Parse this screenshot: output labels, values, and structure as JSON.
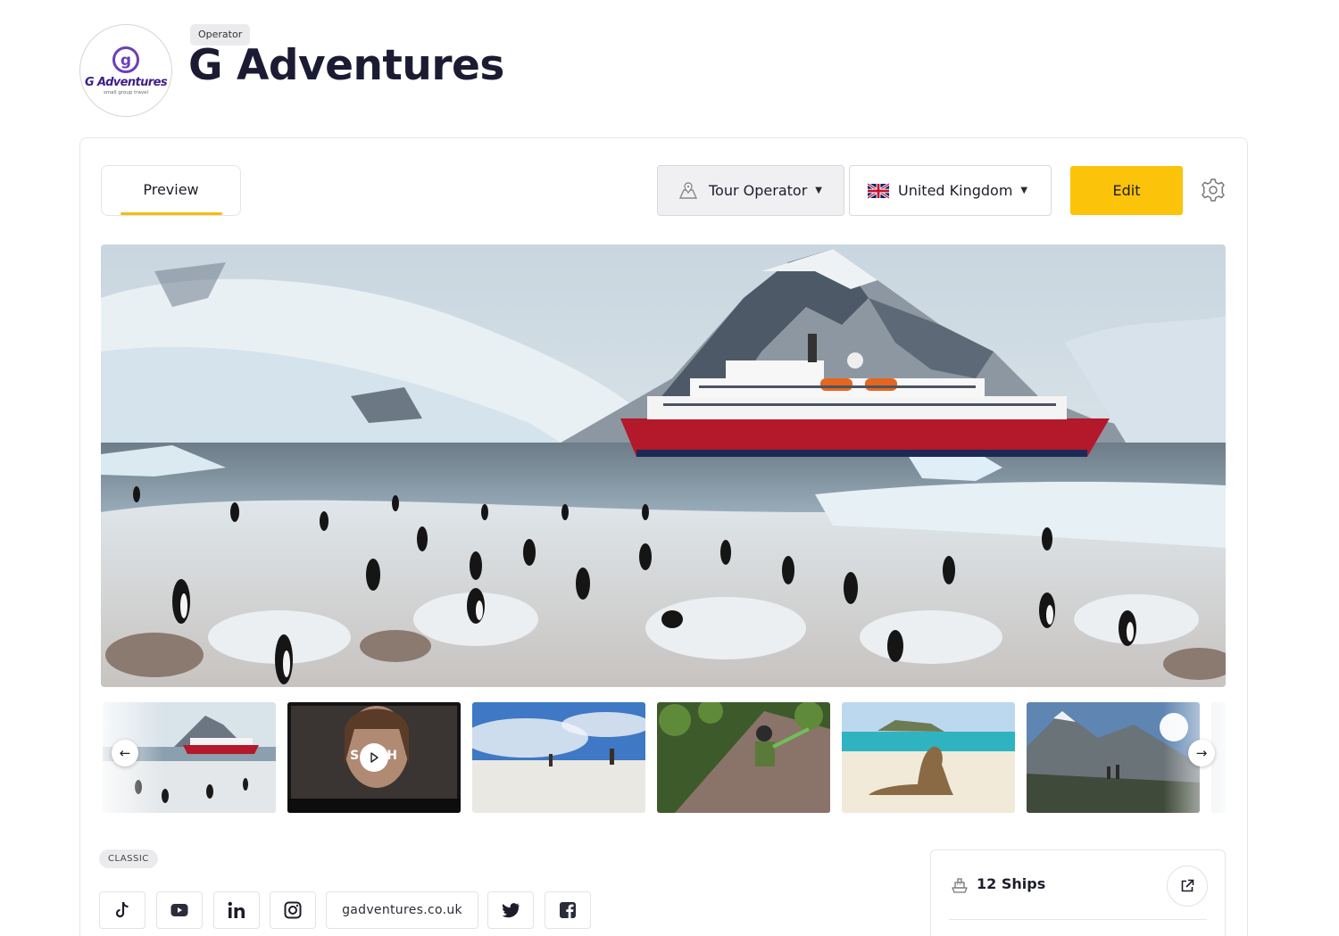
{
  "operator": {
    "type_badge": "Operator",
    "name": "G Adventures",
    "logo_wordmark": "G Adventures",
    "logo_tagline": "small group travel"
  },
  "toolbar": {
    "tab_preview": "Preview",
    "type_select": {
      "value": "Tour Operator",
      "icon": "map-icon"
    },
    "country_select": {
      "value": "United Kingdom",
      "icon": "uk-flag-icon"
    },
    "edit_label": "Edit",
    "settings_icon": "gear-icon"
  },
  "gallery": {
    "hero_alt": "Expedition ship in Antarctica with penguin colony",
    "thumbnails": [
      {
        "kind": "image",
        "subject": "ship-penguins"
      },
      {
        "kind": "video",
        "overlay_text": "SO   CH"
      },
      {
        "kind": "image",
        "subject": "beach-walkers"
      },
      {
        "kind": "image",
        "subject": "climber"
      },
      {
        "kind": "image",
        "subject": "sea-lion-beach"
      },
      {
        "kind": "image",
        "subject": "mountain-hikers"
      }
    ],
    "prev_icon": "arrow-left-icon",
    "next_icon": "arrow-right-icon"
  },
  "badge_classic": "CLASSIC",
  "links": {
    "website": "gadventures.co.uk",
    "socials": [
      "tiktok",
      "youtube",
      "linkedin",
      "instagram",
      "twitter",
      "facebook"
    ]
  },
  "fleet": {
    "ships_label": "12 Ships",
    "ship_icon": "ship-icon",
    "open_icon": "external-link-icon"
  },
  "colors": {
    "accent": "#fbc30a",
    "brand_purple": "#3f2089",
    "title": "#1b1c33"
  }
}
